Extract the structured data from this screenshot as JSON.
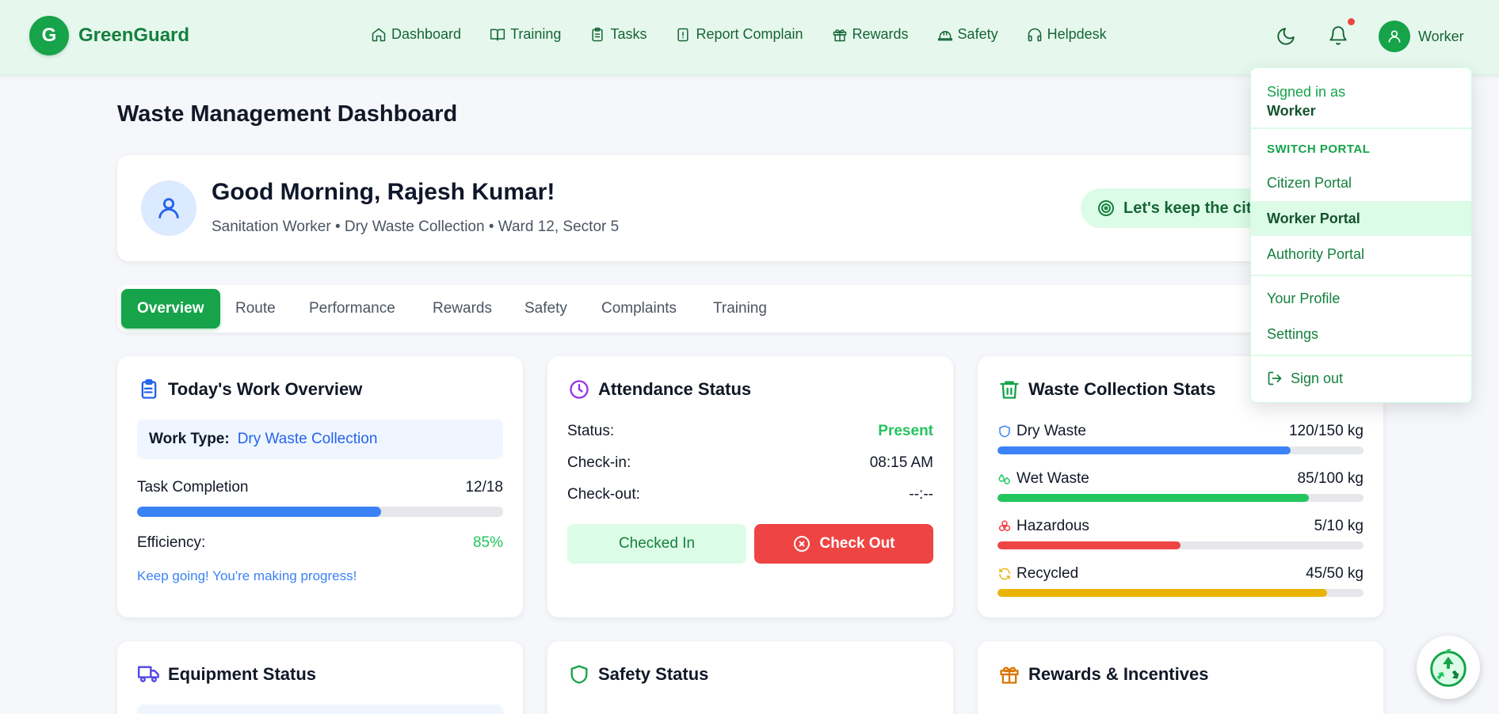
{
  "brand": {
    "logo_letter": "G",
    "name": "GreenGuard"
  },
  "nav": [
    {
      "label": "Dashboard",
      "icon": "home-icon"
    },
    {
      "label": "Training",
      "icon": "book-icon"
    },
    {
      "label": "Tasks",
      "icon": "clipboard-icon"
    },
    {
      "label": "Report Complain",
      "icon": "alert-file-icon"
    },
    {
      "label": "Rewards",
      "icon": "gift-icon"
    },
    {
      "label": "Safety",
      "icon": "hard-hat-icon"
    },
    {
      "label": "Helpdesk",
      "icon": "headphones-icon"
    }
  ],
  "user": {
    "label": "Worker"
  },
  "page": {
    "title": "Waste Management Dashboard"
  },
  "greeting": {
    "title": "Good Morning, Rajesh Kumar!",
    "subtitle": "Sanitation Worker • Dry Waste Collection • Ward 12, Sector 5",
    "motto": "Let's keep the city clean today!"
  },
  "tabs": [
    "Overview",
    "Route",
    "Performance",
    "Rewards",
    "Safety",
    "Complaints",
    "Training"
  ],
  "work_overview": {
    "title": "Today's Work Overview",
    "work_type_label": "Work Type:",
    "work_type_value": "Dry Waste Collection",
    "task_label": "Task Completion",
    "task_value": "12/18",
    "task_progress": 0.667,
    "efficiency_label": "Efficiency:",
    "efficiency_value": "85%",
    "note": "Keep going! You're making progress!"
  },
  "attendance": {
    "title": "Attendance Status",
    "status_label": "Status:",
    "status_value": "Present",
    "checkin_label": "Check-in:",
    "checkin_value": "08:15 AM",
    "checkout_label": "Check-out:",
    "checkout_value": "--:--",
    "checked_in_btn": "Checked In",
    "check_out_btn": "Check Out"
  },
  "waste_stats": {
    "title": "Waste Collection Stats",
    "items": [
      {
        "label": "Dry Waste",
        "value": "120/150 kg",
        "progress": 0.8,
        "color": "#3b82f6",
        "icon": "shield-icon"
      },
      {
        "label": "Wet Waste",
        "value": "85/100 kg",
        "progress": 0.85,
        "color": "#22c55e",
        "icon": "droplets-icon"
      },
      {
        "label": "Hazardous",
        "value": "5/10 kg",
        "progress": 0.5,
        "color": "#ef4444",
        "icon": "biohazard-icon"
      },
      {
        "label": "Recycled",
        "value": "45/50 kg",
        "progress": 0.9,
        "color": "#eab308",
        "icon": "recycle-icon"
      }
    ]
  },
  "bottom_cards": {
    "equipment": "Equipment Status",
    "safety": "Safety Status",
    "rewards": "Rewards & Incentives"
  },
  "dropdown": {
    "signed_in_as": "Signed in as",
    "signed_in_user": "Worker",
    "switch_portal": "SWITCH PORTAL",
    "portals": [
      "Citizen Portal",
      "Worker Portal",
      "Authority Portal"
    ],
    "profile": "Your Profile",
    "settings": "Settings",
    "sign_out": "Sign out"
  },
  "colors": {
    "brand": "#16a34a",
    "primary": "#3b82f6",
    "danger": "#ef4444",
    "warning": "#eab308"
  }
}
